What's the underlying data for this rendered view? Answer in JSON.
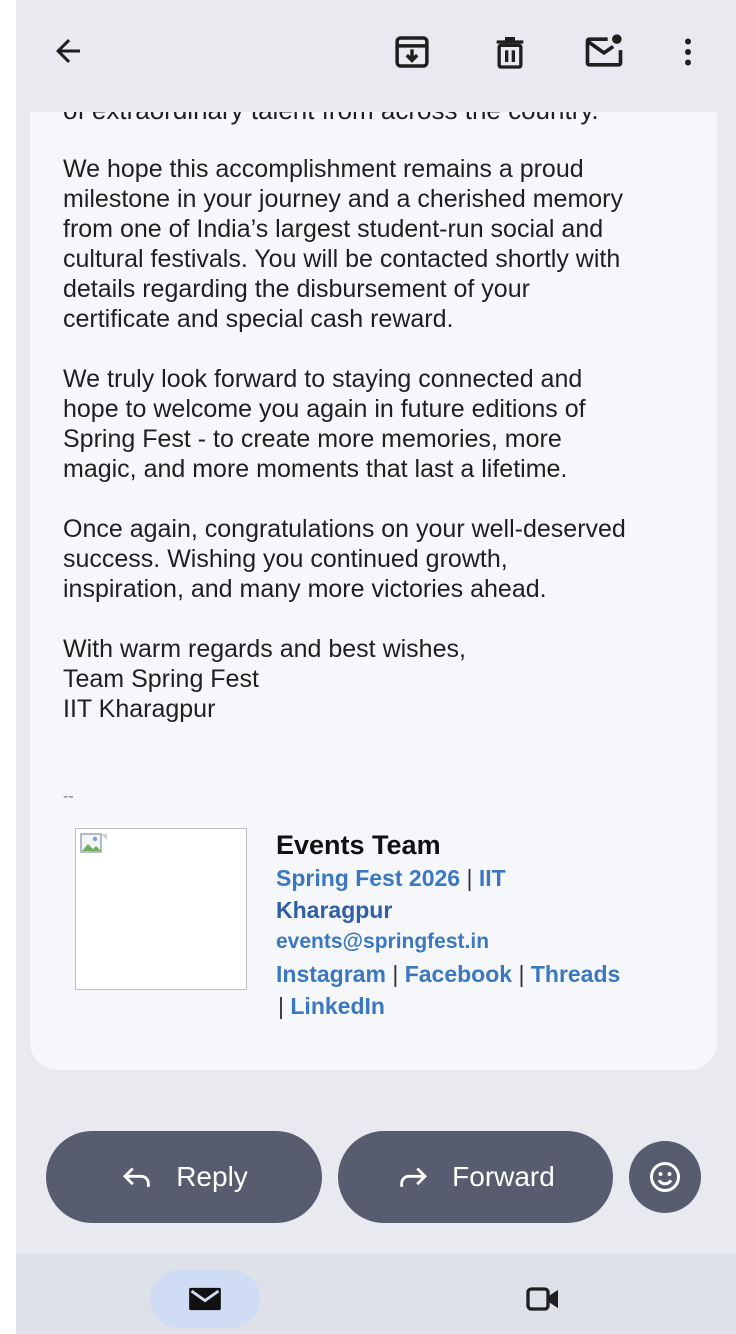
{
  "toolbar": {
    "back_icon": "arrow-left-icon",
    "archive_icon": "archive-icon",
    "delete_icon": "trash-icon",
    "mark_unread_icon": "mark-unread-icon",
    "more_icon": "more-vert-icon"
  },
  "email": {
    "clipped_line": "of extraordinary talent from across the country.",
    "paragraphs": [
      "We hope this accomplishment remains a proud\nmilestone in your journey and a cherished memory\nfrom one of India’s largest student-run social and\ncultural festivals. You will be contacted shortly with\ndetails regarding the disbursement of your\ncertificate and special cash reward.",
      "We truly look forward to staying connected and\nhope to welcome you again in future editions of\nSpring Fest - to create more memories, more\nmagic, and more moments that last a lifetime.",
      "Once again, congratulations on your well-deserved\nsuccess. Wishing you continued growth,\ninspiration, and many more victories ahead.",
      "With warm regards and best wishes,\nTeam Spring Fest\nIIT Kharagpur"
    ],
    "signature_separator": "--",
    "signature": {
      "name": "Events Team",
      "org": "Spring Fest 2026",
      "org_sep": " | ",
      "institute_part1": "IIT",
      "institute_part2": "Kharagpur",
      "email": "events@springfest.in",
      "social": [
        "Instagram",
        "Facebook",
        "Threads",
        "LinkedIn"
      ],
      "social_sep": " | "
    }
  },
  "actions": {
    "reply_label": "Reply",
    "forward_label": "Forward",
    "emoji_icon": "emoji-reaction-icon"
  },
  "bottom_nav": {
    "mail_icon": "mail-icon",
    "meet_icon": "video-camera-icon"
  },
  "colors": {
    "background": "#e8eaef",
    "card": "#f6f7fb",
    "button": "#575c6e",
    "link": "#3b78c2",
    "nav_active": "#cfdcf3"
  }
}
